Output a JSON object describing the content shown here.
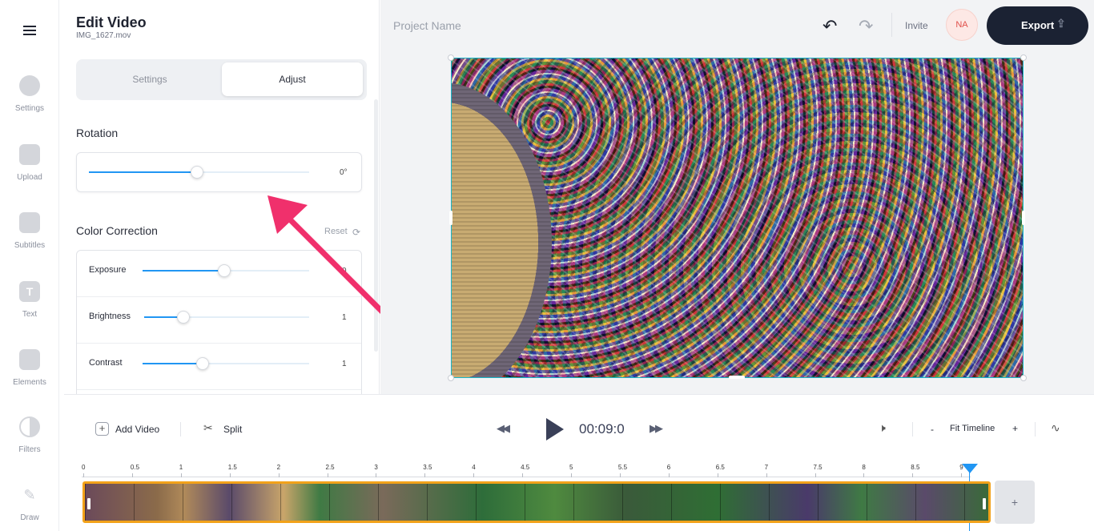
{
  "rail": {
    "items": [
      {
        "label": "Settings",
        "icon": "settings-icon"
      },
      {
        "label": "Upload",
        "icon": "upload-icon"
      },
      {
        "label": "Subtitles",
        "icon": "subtitles-icon"
      },
      {
        "label": "Text",
        "icon": "text-icon"
      },
      {
        "label": "Elements",
        "icon": "elements-icon"
      },
      {
        "label": "Filters",
        "icon": "filters-icon"
      },
      {
        "label": "Draw",
        "icon": "draw-icon"
      }
    ]
  },
  "panel": {
    "title": "Edit Video",
    "filename": "IMG_1627.mov",
    "tabs": [
      {
        "label": "Settings",
        "active": false
      },
      {
        "label": "Adjust",
        "active": true
      }
    ],
    "rotation": {
      "title": "Rotation",
      "value": "0°",
      "level": 0.5
    },
    "color_correction": {
      "title": "Color Correction",
      "reset_label": "Reset",
      "rows": [
        {
          "label": "Exposure",
          "value": "0",
          "level": 0.5
        },
        {
          "label": "Brightness",
          "value": "1",
          "level": 0.24
        },
        {
          "label": "Contrast",
          "value": "1",
          "level": 0.36
        }
      ]
    }
  },
  "header": {
    "project_name": "Project Name",
    "invite_label": "Invite",
    "avatar_initials": "NA",
    "export_label": "Export"
  },
  "timeline": {
    "add_video_label": "Add Video",
    "split_label": "Split",
    "timecode": "00:09:0",
    "fit_label": "Fit Timeline",
    "zoom_out": "-",
    "zoom_in": "+",
    "add_clip": "+",
    "ruler": [
      "0",
      "0.5",
      "1",
      "1.5",
      "2",
      "2.5",
      "3",
      "3.5",
      "4",
      "4.5",
      "5",
      "5.5",
      "6",
      "6.5",
      "7",
      "7.5",
      "8",
      "8.5",
      "9"
    ],
    "playhead_position": 9.0
  },
  "colors": {
    "accent": "#2196f3",
    "export_bg": "#1b2233",
    "clip_border": "#f2a21a",
    "annotation_arrow": "#f0306c"
  }
}
